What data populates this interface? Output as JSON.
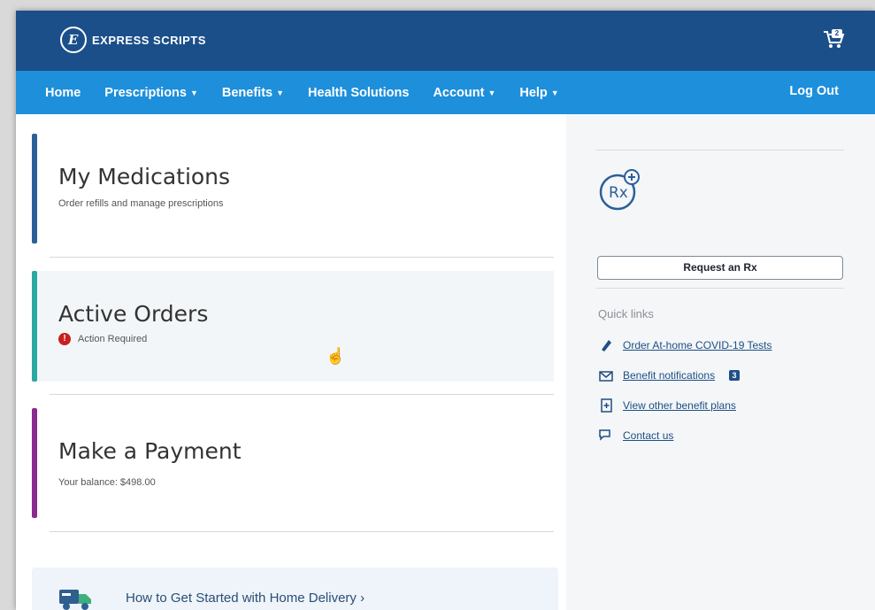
{
  "brand": {
    "name": "EXPRESS SCRIPTS",
    "colors": {
      "header": "#1b4f8a",
      "nav": "#1d8fdb"
    }
  },
  "cart": {
    "count": "2",
    "icon": "cart-icon"
  },
  "nav": {
    "home": "Home",
    "prescriptions": "Prescriptions",
    "benefits": "Benefits",
    "health_solutions": "Health Solutions",
    "account": "Account",
    "help": "Help",
    "logout": "Log Out"
  },
  "cards": {
    "medications": {
      "title": "My Medications",
      "subtitle": "Order refills and manage prescriptions",
      "accent": "#2b5f9a"
    },
    "orders": {
      "title": "Active Orders",
      "status": "Action Required",
      "accent": "#2aa9a0"
    },
    "payment": {
      "title": "Make a Payment",
      "balance": "Your balance: $498.00",
      "accent": "#8b2a8f"
    }
  },
  "delivery": {
    "label": "How to Get Started with Home Delivery ›",
    "icon": "delivery-truck-icon"
  },
  "sidebar": {
    "request_button": "Request an Rx",
    "quick_links_title": "Quick links",
    "links": [
      {
        "label": "Order At-home COVID-19 Tests",
        "icon": "test-kit-icon"
      },
      {
        "label": "Benefit notifications",
        "icon": "notification-envelope-icon",
        "badge": "3"
      },
      {
        "label": "View other benefit plans",
        "icon": "document-plus-icon"
      },
      {
        "label": "Contact us",
        "icon": "chat-icon"
      }
    ]
  }
}
